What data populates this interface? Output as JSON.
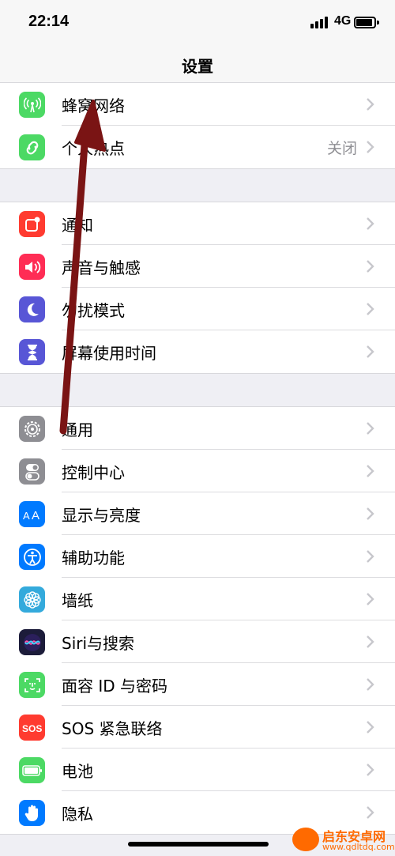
{
  "status": {
    "time": "22:14",
    "network": "4G"
  },
  "nav": {
    "title": "设置"
  },
  "groups": [
    [
      {
        "label": "蜂窝网络",
        "icon": "antenna-icon",
        "color": "#4cd964"
      },
      {
        "label": "个人热点",
        "value": "关闭",
        "icon": "hotspot-icon",
        "color": "#4cd964"
      }
    ],
    [
      {
        "label": "通知",
        "icon": "notification-icon",
        "color": "#ff3b30"
      },
      {
        "label": "声音与触感",
        "icon": "speaker-icon",
        "color": "#ff2d55"
      },
      {
        "label": "勿扰模式",
        "icon": "moon-icon",
        "color": "#5856d6"
      },
      {
        "label": "屏幕使用时间",
        "icon": "hourglass-icon",
        "color": "#5856d6"
      }
    ],
    [
      {
        "label": "通用",
        "icon": "gear-icon",
        "color": "#8e8e93"
      },
      {
        "label": "控制中心",
        "icon": "toggles-icon",
        "color": "#8e8e93"
      },
      {
        "label": "显示与亮度",
        "icon": "text-size-icon",
        "color": "#007aff"
      },
      {
        "label": "辅助功能",
        "icon": "accessibility-icon",
        "color": "#007aff"
      },
      {
        "label": "墙纸",
        "icon": "flower-icon",
        "color": "#34aadc"
      },
      {
        "label": "Siri与搜索",
        "icon": "siri-icon",
        "color": "#1c1c3a"
      },
      {
        "label": "面容 ID 与密码",
        "icon": "face-id-icon",
        "color": "#4cd964"
      },
      {
        "label": "SOS 紧急联络",
        "icon": "sos-icon",
        "color": "#ff3b30"
      },
      {
        "label": "电池",
        "icon": "battery-icon",
        "color": "#4cd964"
      },
      {
        "label": "隐私",
        "icon": "hand-icon",
        "color": "#007aff"
      }
    ]
  ],
  "watermark": {
    "name": "启东安卓网",
    "url": "www.qdltdq.com"
  },
  "colors": {
    "arrow": "#7a1414",
    "chevron": "#c7c7cc",
    "separator": "#dcdcdf"
  }
}
